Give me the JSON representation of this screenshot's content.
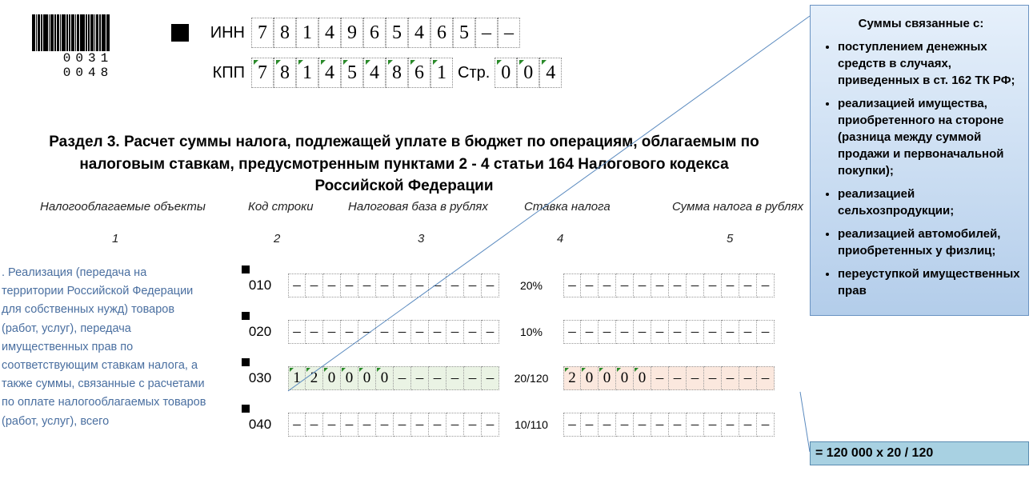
{
  "barcode": {
    "text": "0031 0048"
  },
  "ids": {
    "inn_label": "ИНН",
    "inn": [
      "7",
      "8",
      "1",
      "4",
      "9",
      "6",
      "5",
      "4",
      "6",
      "5",
      "–",
      "–"
    ],
    "kpp_label": "КПП",
    "kpp": [
      "7",
      "8",
      "1",
      "4",
      "5",
      "4",
      "8",
      "6",
      "1"
    ],
    "page_label": "Стр.",
    "page": [
      "0",
      "0",
      "4"
    ]
  },
  "heading": "Раздел 3. Расчет суммы налога, подлежащей уплате в бюджет по операциям, облагаемым по налоговым ставкам, предусмотренным пунктами 2 - 4 статьи 164 Налогового кодекса Российской Федерации",
  "columns": {
    "h1": "Налогооблагаемые объекты",
    "h2": "Код строки",
    "h3": "Налоговая база в рублях",
    "h4": "Ставка налога",
    "h5": "Сумма налога в рублях",
    "n1": "1",
    "n2": "2",
    "n3": "3",
    "n4": "4",
    "n5": "5"
  },
  "desc": ". Реализация (передача на территории Российской Федерации для собственных нужд) товаров (работ, услуг), передача имущественных прав по соответствующим ставкам налога, а также суммы, связанные с расчетами по оплате налогооблагаемых товаров (работ, услуг), всего",
  "rows": [
    {
      "code": "010",
      "base": [
        "–",
        "–",
        "–",
        "–",
        "–",
        "–",
        "–",
        "–",
        "–",
        "–",
        "–",
        "–"
      ],
      "rate": "20%",
      "tax": [
        "–",
        "–",
        "–",
        "–",
        "–",
        "–",
        "–",
        "–",
        "–",
        "–",
        "–",
        "–"
      ],
      "hl": false
    },
    {
      "code": "020",
      "base": [
        "–",
        "–",
        "–",
        "–",
        "–",
        "–",
        "–",
        "–",
        "–",
        "–",
        "–",
        "–"
      ],
      "rate": "10%",
      "tax": [
        "–",
        "–",
        "–",
        "–",
        "–",
        "–",
        "–",
        "–",
        "–",
        "–",
        "–",
        "–"
      ],
      "hl": false
    },
    {
      "code": "030",
      "base": [
        "1",
        "2",
        "0",
        "0",
        "0",
        "0",
        "–",
        "–",
        "–",
        "–",
        "–",
        "–"
      ],
      "rate": "20/120",
      "tax": [
        "2",
        "0",
        "0",
        "0",
        "0",
        "–",
        "–",
        "–",
        "–",
        "–",
        "–",
        "–"
      ],
      "hl": true
    },
    {
      "code": "040",
      "base": [
        "–",
        "–",
        "–",
        "–",
        "–",
        "–",
        "–",
        "–",
        "–",
        "–",
        "–",
        "–"
      ],
      "rate": "10/110",
      "tax": [
        "–",
        "–",
        "–",
        "–",
        "–",
        "–",
        "–",
        "–",
        "–",
        "–",
        "–",
        "–"
      ],
      "hl": false
    }
  ],
  "annotation": {
    "title": "Суммы связанные с:",
    "items": [
      "поступлением денежных средств в случаях, приведенных в ст. 162 ТК РФ;",
      "реализацией имущества, приобретенного на стороне (разница между суммой продажи и первоначальной покупки);",
      "реализацией сельхозпродукции;",
      "реализацией автомобилей, приобретенных у физлиц;",
      "переуступкой имущественных прав"
    ]
  },
  "calc": "=  120 000 х 20 / 120"
}
